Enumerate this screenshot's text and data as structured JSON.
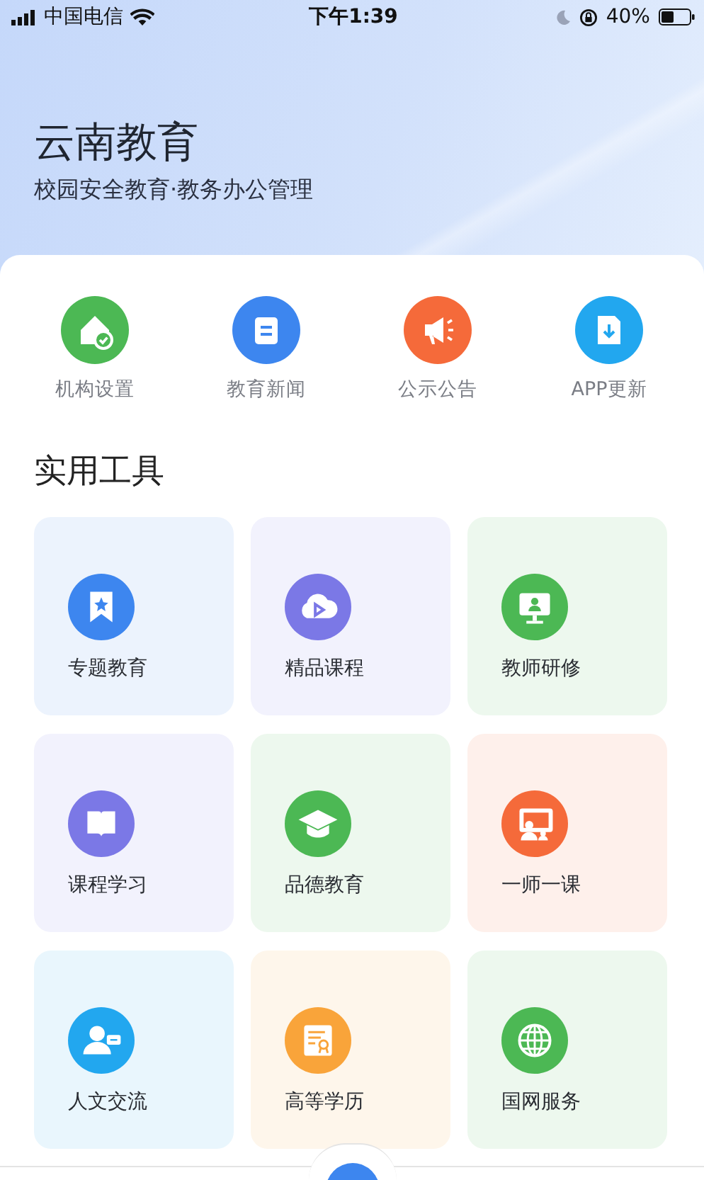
{
  "status_bar": {
    "carrier": "中国电信",
    "time": "下午1:39",
    "battery": "40%"
  },
  "header": {
    "title": "云南教育",
    "subtitle": "校园安全教育·教务办公管理"
  },
  "quick_links": [
    {
      "label": "机构设置",
      "color": "#4cb854"
    },
    {
      "label": "教育新闻",
      "color": "#3d86ef"
    },
    {
      "label": "公示公告",
      "color": "#f56a3a"
    },
    {
      "label": "APP更新",
      "color": "#22a7ef"
    }
  ],
  "section_title": "实用工具",
  "tools": [
    {
      "label": "专题教育",
      "color": "#3d86ef"
    },
    {
      "label": "精品课程",
      "color": "#7b78e6"
    },
    {
      "label": "教师研修",
      "color": "#4cb854"
    },
    {
      "label": "课程学习",
      "color": "#7b78e6"
    },
    {
      "label": "品德教育",
      "color": "#4cb854"
    },
    {
      "label": "一师一课",
      "color": "#f56a3a"
    },
    {
      "label": "人文交流",
      "color": "#22a7ef"
    },
    {
      "label": "高等学历",
      "color": "#f9a43a"
    },
    {
      "label": "国网服务",
      "color": "#4cb854"
    }
  ]
}
